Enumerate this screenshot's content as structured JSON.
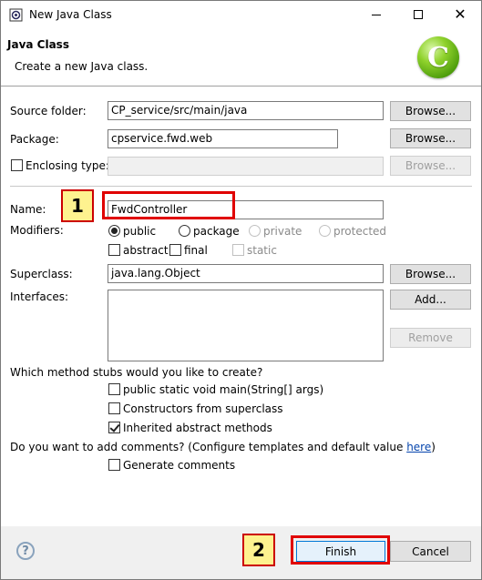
{
  "window": {
    "title": "New Java Class"
  },
  "header": {
    "title": "Java Class",
    "description": "Create a new Java class."
  },
  "form": {
    "source_folder": {
      "label": "Source folder:",
      "value": "CP_service/src/main/java",
      "browse": "Browse..."
    },
    "package": {
      "label": "Package:",
      "value": "cpservice.fwd.web",
      "browse": "Browse..."
    },
    "enclosing_type": {
      "label": "Enclosing type:",
      "value": "",
      "browse": "Browse...",
      "checked": false
    },
    "name": {
      "label": "Name:",
      "value": "FwdController"
    },
    "modifiers": {
      "label": "Modifiers:",
      "public": "public",
      "package": "package",
      "private": "private",
      "protected": "protected",
      "abstract": "abstract",
      "final": "final",
      "static": "static",
      "selected": "public"
    },
    "superclass": {
      "label": "Superclass:",
      "value": "java.lang.Object",
      "browse": "Browse..."
    },
    "interfaces": {
      "label": "Interfaces:",
      "add": "Add...",
      "remove": "Remove"
    },
    "stubs": {
      "question": "Which method stubs would you like to create?",
      "main": "public static void main(String[] args)",
      "constructors": "Constructors from superclass",
      "inherited": "Inherited abstract methods",
      "main_checked": false,
      "constructors_checked": false,
      "inherited_checked": true
    },
    "comments": {
      "question": "Do you want to add comments? (Configure templates and default value ",
      "link": "here",
      "close": ")",
      "generate": "Generate comments",
      "generate_checked": false
    }
  },
  "footer": {
    "help": "?",
    "finish": "Finish",
    "cancel": "Cancel"
  },
  "annotations": {
    "marker1": "1",
    "marker2": "2"
  },
  "colors": {
    "highlight_red": "#e00000",
    "marker_yellow": "#fef28f",
    "badge_green": "#5cb814"
  }
}
